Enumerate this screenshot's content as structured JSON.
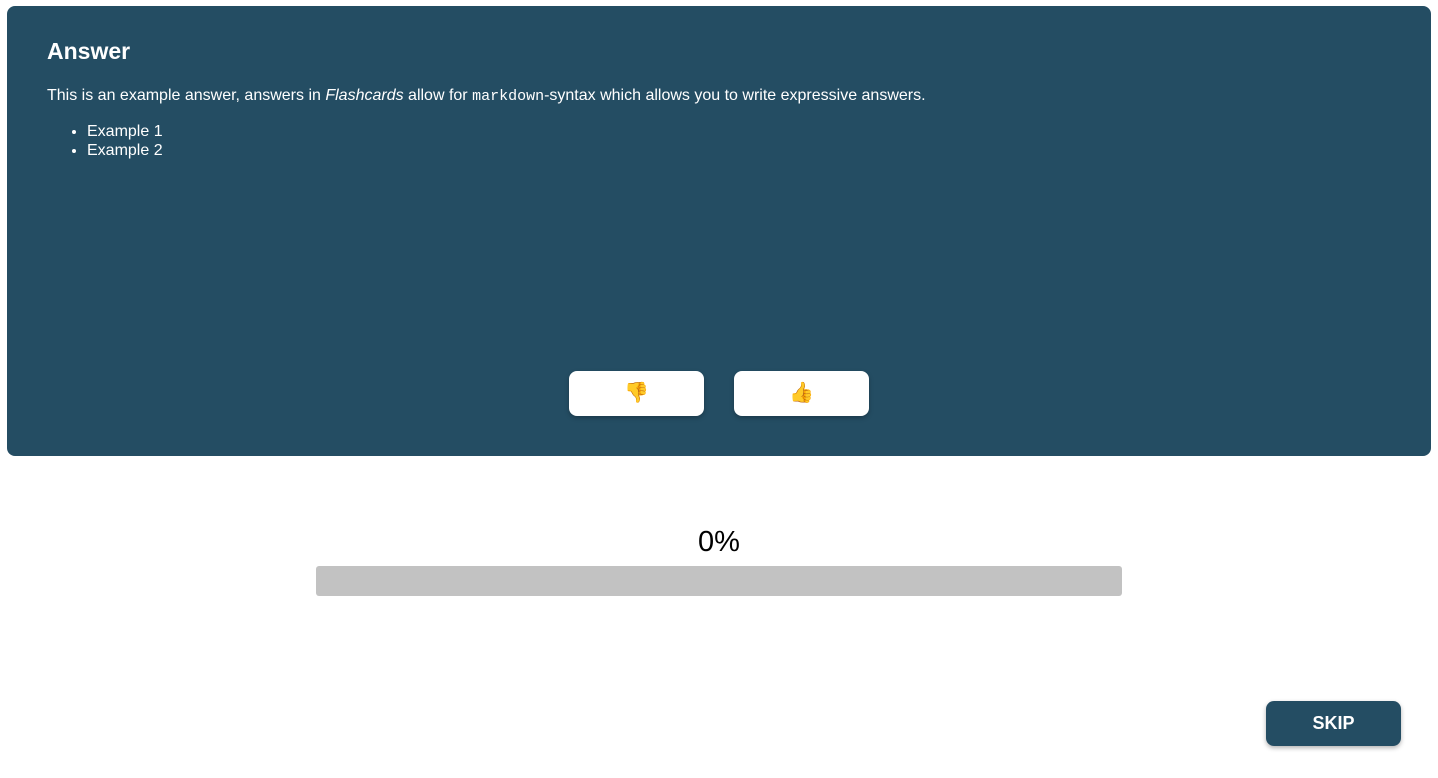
{
  "card": {
    "title": "Answer",
    "text_before": "This is an example answer, answers in ",
    "emphasis": "Flashcards",
    "text_middle": " allow for ",
    "code": "markdown",
    "text_after": "-syntax which allows you to write expressive answers.",
    "list_items": [
      "Example 1",
      "Example 2"
    ]
  },
  "vote": {
    "thumbs_down_icon": "thumbs-down-icon",
    "thumbs_down_glyph": "👎",
    "thumbs_up_icon": "thumbs-up-icon",
    "thumbs_up_glyph": "👍"
  },
  "progress": {
    "label": "0%",
    "fraction": 0
  },
  "skip": {
    "label": "SKIP"
  },
  "colors": {
    "card_bg": "#244d63",
    "progress_track": "#c2c2c2",
    "button_bg": "#ffffff"
  }
}
